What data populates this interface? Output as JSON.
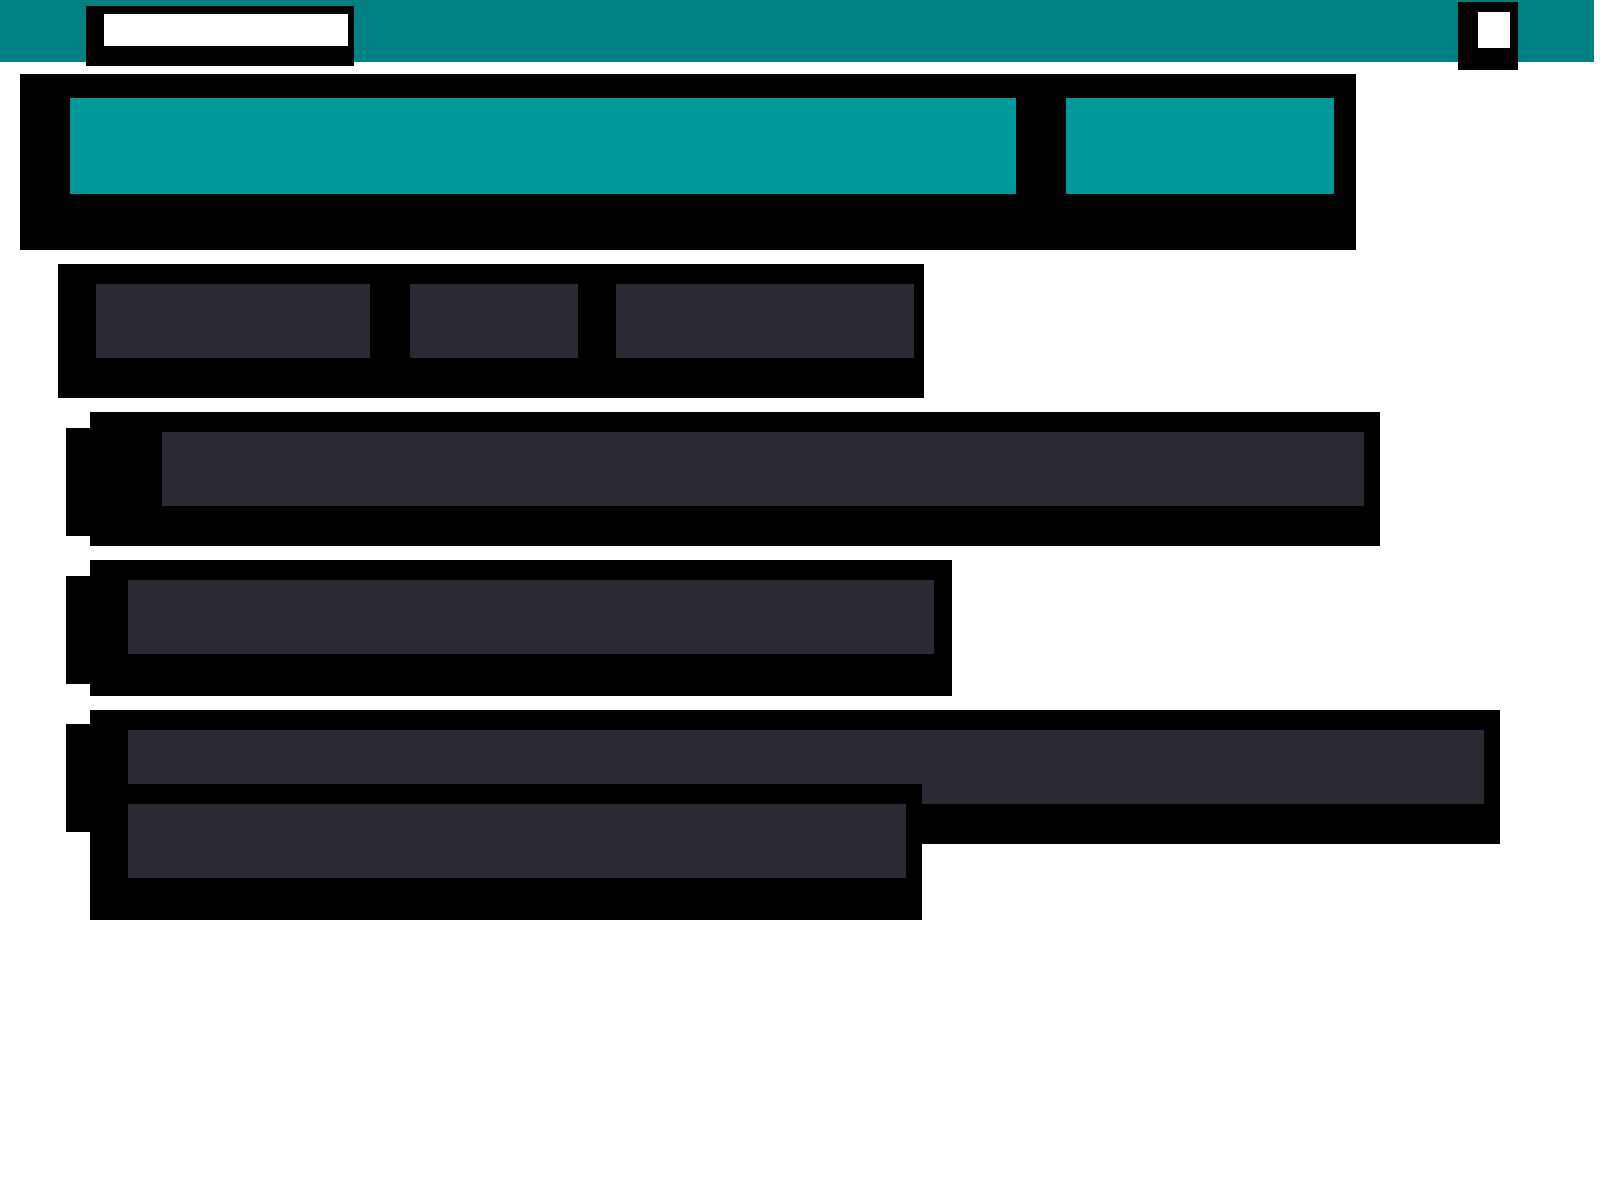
{
  "top_bar": {
    "items": [
      {
        "kind": "field"
      },
      {
        "kind": "square"
      }
    ]
  },
  "banner": {
    "blocks": [
      {
        "kind": "highlight"
      },
      {
        "kind": "highlight"
      }
    ]
  },
  "toolbar": {
    "blocks": [
      {
        "kind": "redacted"
      },
      {
        "kind": "redacted"
      },
      {
        "kind": "redacted"
      }
    ]
  },
  "rows": [
    {
      "lines": [
        {
          "kind": "redacted"
        }
      ]
    },
    {
      "lines": [
        {
          "kind": "redacted"
        }
      ]
    },
    {
      "lines": [
        {
          "kind": "redacted"
        },
        {
          "kind": "redacted"
        }
      ]
    }
  ]
}
